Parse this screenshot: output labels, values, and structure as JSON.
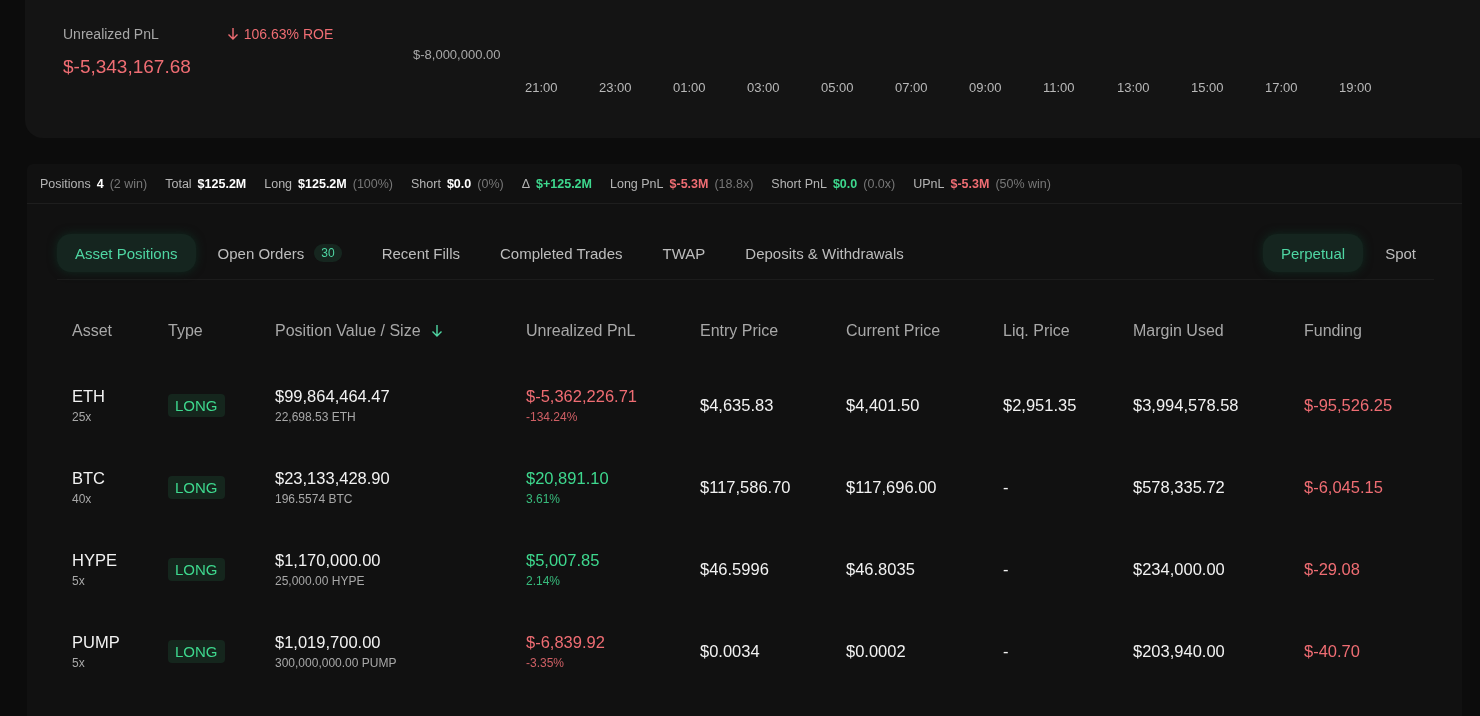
{
  "pnl_card": {
    "label": "Unrealized PnL",
    "value": "$-5,343,167.68",
    "color": "#ef6d73",
    "roe": "106.63% ROE",
    "chart": {
      "y_label": "$-8,000,000.00",
      "x_labels": [
        "21:00",
        "23:00",
        "01:00",
        "03:00",
        "05:00",
        "07:00",
        "09:00",
        "11:00",
        "13:00",
        "15:00",
        "17:00",
        "19:00"
      ]
    }
  },
  "stats": [
    {
      "label": "Positions",
      "value": "4",
      "note": "(2 win)",
      "color": "#ffffff"
    },
    {
      "label": "Total",
      "value": "$125.2M",
      "color": "#ffffff"
    },
    {
      "label": "Long",
      "value": "$125.2M",
      "note": "(100%)",
      "color": "#ffffff"
    },
    {
      "label": "Short",
      "value": "$0.0",
      "note": "(0%)",
      "color": "#ffffff"
    },
    {
      "label": "Δ",
      "value": "$+125.2M",
      "color": "#3ed88e"
    },
    {
      "label": "Long PnL",
      "value": "$-5.3M",
      "note": "(18.8x)",
      "color": "#ef6d73"
    },
    {
      "label": "Short PnL",
      "value": "$0.0",
      "note": "(0.0x)",
      "color": "#3ed88e"
    },
    {
      "label": "UPnL",
      "value": "$-5.3M",
      "note": "(50% win)",
      "color": "#ef6d73"
    }
  ],
  "tabs": [
    {
      "label": "Asset Positions",
      "selected": true
    },
    {
      "label": "Open Orders",
      "count": "30",
      "selected": false
    },
    {
      "label": "Recent Fills",
      "selected": false
    },
    {
      "label": "Completed Trades",
      "selected": false
    },
    {
      "label": "TWAP",
      "selected": false
    },
    {
      "label": "Deposits & Withdrawals",
      "selected": false
    }
  ],
  "market_toggle": [
    {
      "label": "Perpetual",
      "selected": true
    },
    {
      "label": "Spot",
      "selected": false
    }
  ],
  "table": {
    "columns": [
      {
        "label": "Asset"
      },
      {
        "label": "Type"
      },
      {
        "label": "Position Value / Size",
        "sorted": true
      },
      {
        "label": "Unrealized PnL"
      },
      {
        "label": "Entry Price"
      },
      {
        "label": "Current Price"
      },
      {
        "label": "Liq. Price"
      },
      {
        "label": "Margin Used"
      },
      {
        "label": "Funding"
      }
    ],
    "rows": [
      {
        "asset": "ETH",
        "leverage": "25x",
        "type": "LONG",
        "value": "$99,864,464.47",
        "size": "22,698.53 ETH",
        "pnl": "$-5,362,226.71",
        "pnl_pct": "-134.24%",
        "color": "#ef6d73",
        "entry": "$4,635.83",
        "current": "$4,401.50",
        "liq": "$2,951.35",
        "margin": "$3,994,578.58",
        "funding": "$-95,526.25"
      },
      {
        "asset": "BTC",
        "leverage": "40x",
        "type": "LONG",
        "value": "$23,133,428.90",
        "size": "196.5574 BTC",
        "pnl": "$20,891.10",
        "pnl_pct": "3.61%",
        "color": "#3ed88e",
        "entry": "$117,586.70",
        "current": "$117,696.00",
        "liq": "-",
        "margin": "$578,335.72",
        "funding": "$-6,045.15"
      },
      {
        "asset": "HYPE",
        "leverage": "5x",
        "type": "LONG",
        "value": "$1,170,000.00",
        "size": "25,000.00 HYPE",
        "pnl": "$5,007.85",
        "pnl_pct": "2.14%",
        "color": "#3ed88e",
        "entry": "$46.5996",
        "current": "$46.8035",
        "liq": "-",
        "margin": "$234,000.00",
        "funding": "$-29.08"
      },
      {
        "asset": "PUMP",
        "leverage": "5x",
        "type": "LONG",
        "value": "$1,019,700.00",
        "size": "300,000,000.00 PUMP",
        "pnl": "$-6,839.92",
        "pnl_pct": "-3.35%",
        "color": "#ef6d73",
        "entry": "$0.0034",
        "current": "$0.0002",
        "liq": "-",
        "margin": "$203,940.00",
        "funding": "$-40.70"
      }
    ]
  }
}
